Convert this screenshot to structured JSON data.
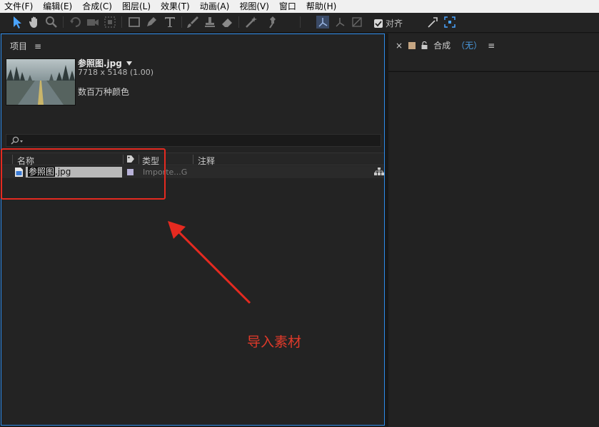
{
  "menu": [
    "文件(F)",
    "编辑(E)",
    "合成(C)",
    "图层(L)",
    "效果(T)",
    "动画(A)",
    "视图(V)",
    "窗口",
    "帮助(H)"
  ],
  "toolbar": {
    "snap_label": "对齐"
  },
  "project": {
    "tab_label": "项目",
    "menu_glyph": "≡",
    "asset_name": "参照图.jpg",
    "asset_dims": "7718 x 5148 (1.00)",
    "asset_color": "数百万种颜色",
    "columns": {
      "name": "名称",
      "type": "类型",
      "comment": "注释"
    },
    "row": {
      "name_selected": "参照图",
      "name_ext": ".jpg",
      "type": "Importe...G",
      "label_color": "#b8b2d8"
    }
  },
  "composition": {
    "close_glyph": "×",
    "label": "合成",
    "value": "（无）",
    "menu_glyph": "≡"
  },
  "annotation": {
    "text": "导入素材",
    "color": "#e03a2a"
  },
  "accent": "#2d8ceb"
}
